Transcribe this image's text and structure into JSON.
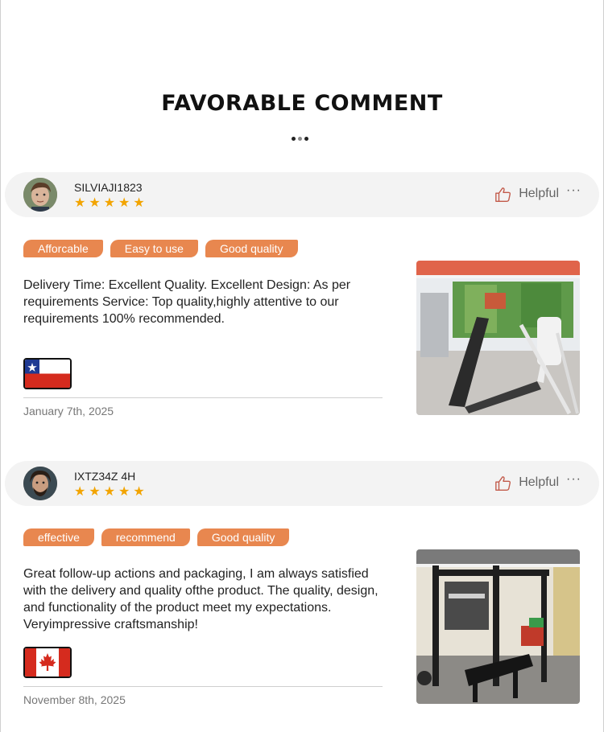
{
  "section": {
    "title": "FAVORABLE COMMENT"
  },
  "reviews": [
    {
      "username": "SILVIAJI1823",
      "stars": "★★★★★",
      "helpful_label": "Helpful",
      "more_label": "···",
      "tags": [
        "Afforcable",
        "Easy to use",
        "Good quality"
      ],
      "text": "Delivery Time: Excellent Quality. Excellent Design: As per requirements Service: Top quality,highly attentive to our requirements 100% recommended.",
      "flag_icon": "chile-flag-icon",
      "date": "January 7th, 2025",
      "photo_icon": "treadmill-photo"
    },
    {
      "username": "IXTZ34Z 4H",
      "stars": "★★★★★",
      "helpful_label": "Helpful",
      "more_label": "···",
      "tags": [
        "effective",
        "recommend",
        "Good quality"
      ],
      "text": "Great follow-up actions and packaging, I am always satisfied with the delivery and quality ofthe product. The quality, design, and functionality of the product meet my expectations. Veryimpressive craftsmanship!",
      "flag_icon": "canada-flag-icon",
      "date": "November 8th, 2025",
      "photo_icon": "smith-machine-photo"
    }
  ],
  "colors": {
    "tag": "#e8874f",
    "star": "#f2a400",
    "bar": "#f3f3f3"
  }
}
